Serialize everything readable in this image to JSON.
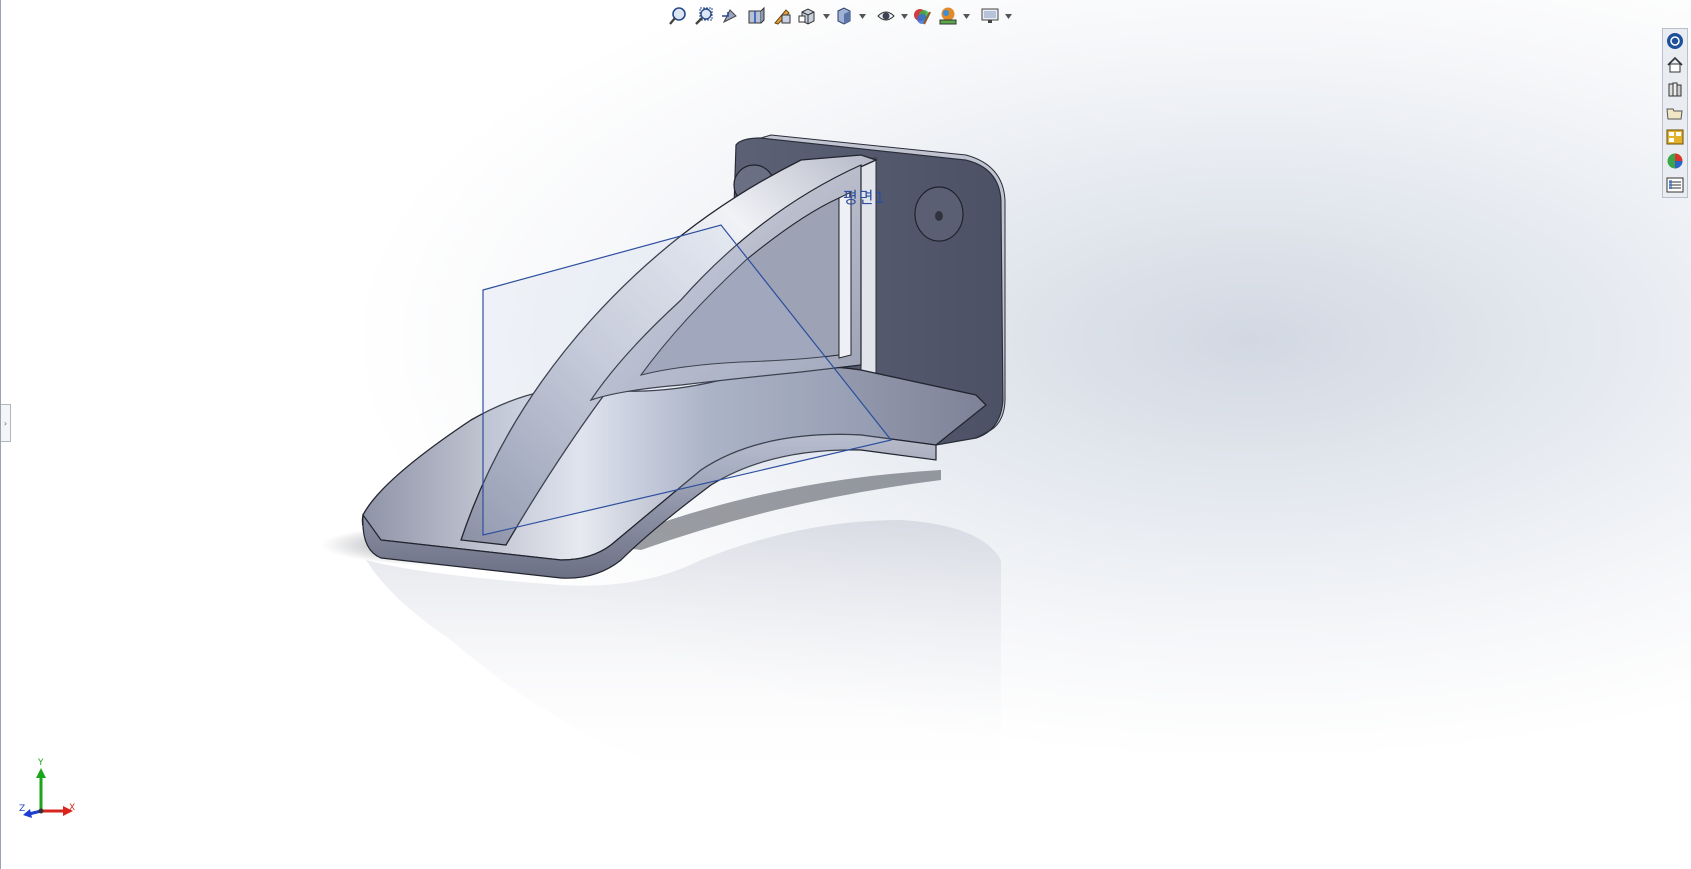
{
  "viewport": {
    "background_top": "#ffffff",
    "background_accent": "#d2d8e2",
    "plane_label": "평면1"
  },
  "heads_up_toolbar": {
    "buttons": [
      {
        "icon": "zoom-to-fit-icon"
      },
      {
        "icon": "zoom-to-area-icon"
      },
      {
        "icon": "previous-view-icon"
      },
      {
        "icon": "section-view-icon"
      },
      {
        "icon": "dynamic-annotation-views-icon"
      },
      {
        "icon": "view-orientation-icon",
        "dropdown": true
      },
      {
        "icon": "display-style-icon",
        "dropdown": true
      },
      {
        "icon": "hide-show-items-icon",
        "dropdown": true
      },
      {
        "icon": "edit-appearance-icon"
      },
      {
        "icon": "apply-scene-icon",
        "dropdown": true
      },
      {
        "icon": "view-settings-icon",
        "dropdown": true
      }
    ]
  },
  "task_pane": {
    "tabs": [
      {
        "icon": "solidworks-resources-icon"
      },
      {
        "icon": "home-icon"
      },
      {
        "icon": "design-library-icon"
      },
      {
        "icon": "file-explorer-icon"
      },
      {
        "icon": "view-palette-icon"
      },
      {
        "icon": "appearances-scenes-icon"
      },
      {
        "icon": "custom-properties-icon"
      }
    ]
  },
  "triad": {
    "x_label": "X",
    "y_label": "Y",
    "z_label": "Z",
    "x_color": "#d9261c",
    "y_color": "#1aa51a",
    "z_color": "#1c3fd1"
  },
  "colors": {
    "part_face": "#9aa0b4",
    "part_dark": "#555a6e",
    "part_light": "#d8dbe6",
    "plane_edge": "#2d4f9e"
  }
}
